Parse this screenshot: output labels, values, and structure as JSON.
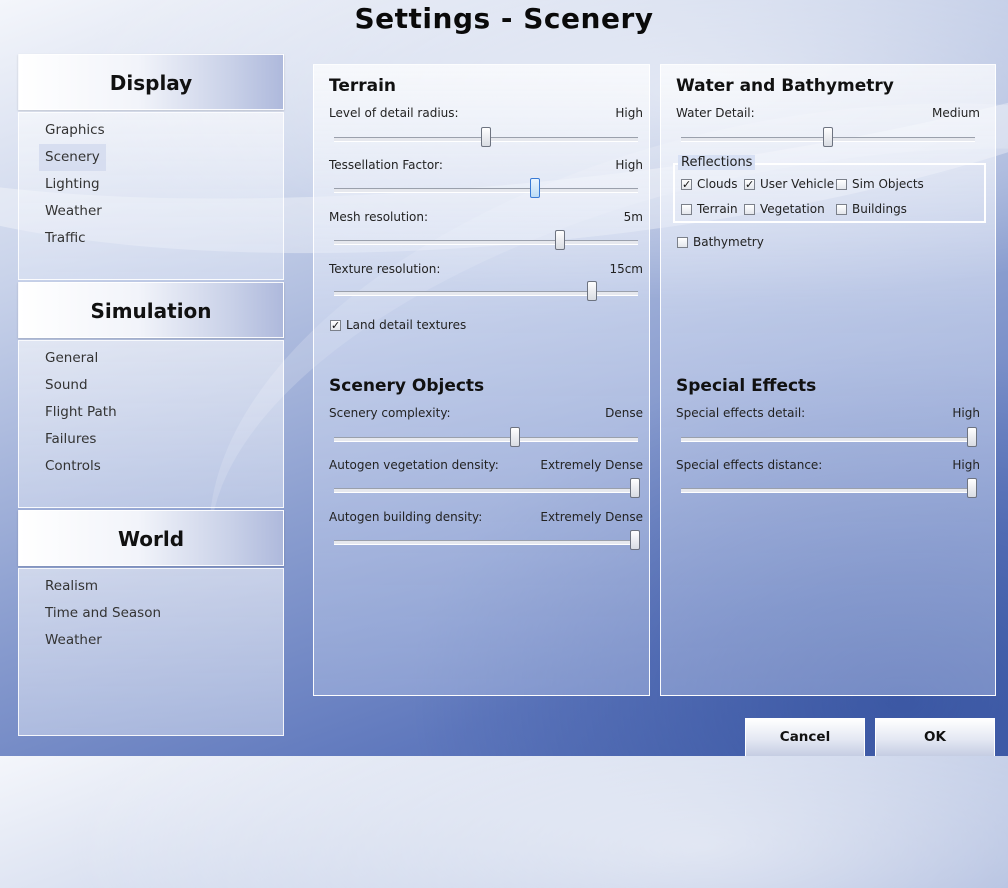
{
  "window": {
    "title": "Settings - Scenery"
  },
  "nav": {
    "display": {
      "header": "Display",
      "items": [
        "Graphics",
        "Scenery",
        "Lighting",
        "Weather",
        "Traffic"
      ]
    },
    "simulation": {
      "header": "Simulation",
      "items": [
        "General",
        "Sound",
        "Flight Path",
        "Failures",
        "Controls"
      ]
    },
    "world": {
      "header": "World",
      "items": [
        "Realism",
        "Time and Season",
        "Weather"
      ]
    }
  },
  "terrain": {
    "title": "Terrain",
    "level_of_detail": {
      "label": "Level of detail radius:",
      "value": "High",
      "level": 0.5
    },
    "tessellation": {
      "label": "Tessellation Factor:",
      "value": "High",
      "level": 0.667
    },
    "mesh": {
      "label": "Mesh resolution:",
      "value": "5m",
      "level": 0.75
    },
    "texture": {
      "label": "Texture resolution:",
      "value": "15cm",
      "level": 0.857
    },
    "land_detail": {
      "label": "Land detail textures",
      "checked": true
    }
  },
  "scenery_objects": {
    "title": "Scenery Objects",
    "complexity": {
      "label": "Scenery complexity:",
      "value": "Dense",
      "level": 0.6
    },
    "vegetation": {
      "label": "Autogen vegetation density:",
      "value": "Extremely Dense",
      "level": 1.0
    },
    "building": {
      "label": "Autogen building density:",
      "value": "Extremely Dense",
      "level": 1.0
    }
  },
  "water": {
    "title": "Water and Bathymetry",
    "detail": {
      "label": "Water Detail:",
      "value": "Medium",
      "level": 0.5
    },
    "reflections": {
      "legend": "Reflections",
      "clouds": {
        "label": "Clouds",
        "checked": true
      },
      "user_vehicle": {
        "label": "User Vehicle",
        "checked": true
      },
      "sim_objects": {
        "label": "Sim Objects",
        "checked": false
      },
      "terrain": {
        "label": "Terrain",
        "checked": false
      },
      "vegetation": {
        "label": "Vegetation",
        "checked": false
      },
      "buildings": {
        "label": "Buildings",
        "checked": false
      }
    },
    "bathymetry": {
      "label": "Bathymetry",
      "checked": false
    }
  },
  "special_effects": {
    "title": "Special Effects",
    "detail": {
      "label": "Special effects detail:",
      "value": "High",
      "level": 1.0
    },
    "distance": {
      "label": "Special effects distance:",
      "value": "High",
      "level": 1.0
    }
  },
  "buttons": {
    "cancel": "Cancel",
    "ok": "OK"
  },
  "check_glyph": "✓"
}
